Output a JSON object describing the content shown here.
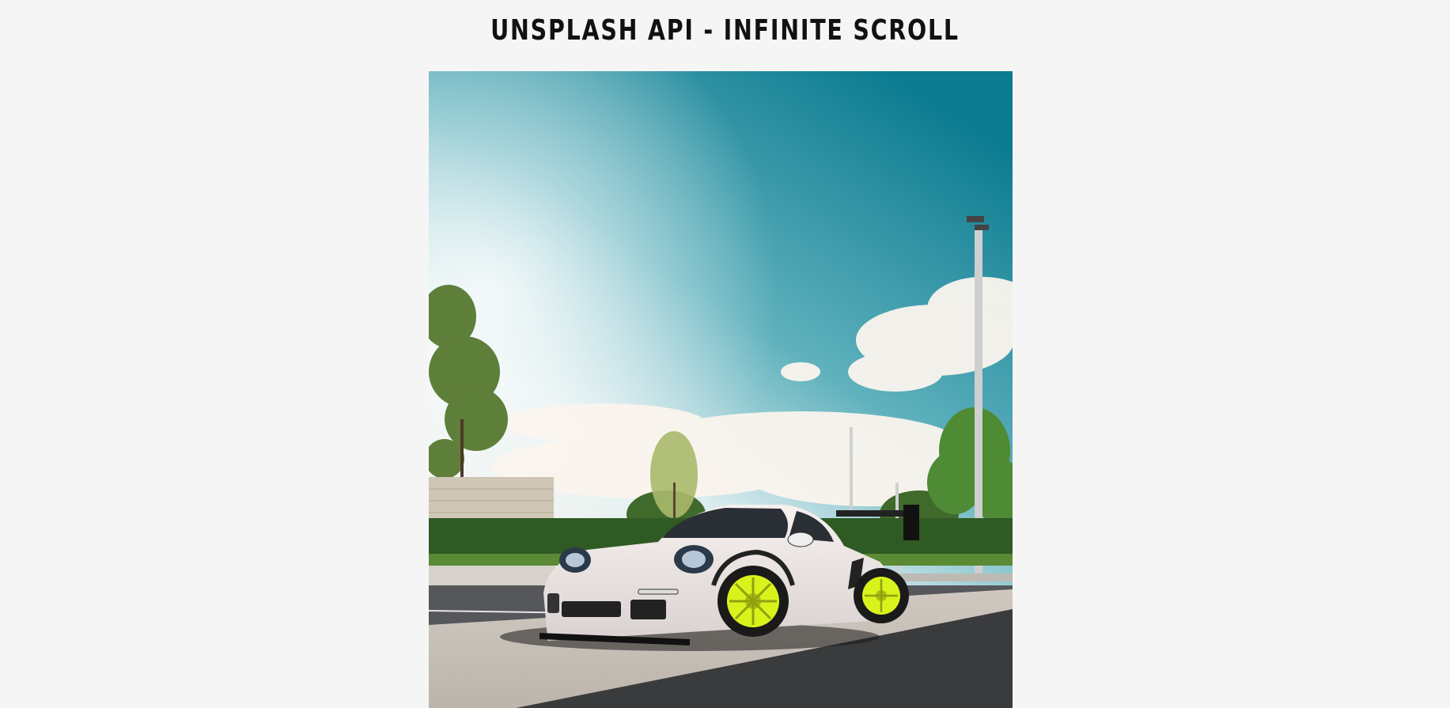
{
  "header": {
    "title": "UNSPLASH API - INFINITE SCROLL"
  },
  "gallery": {
    "images": [
      {
        "subject": "white sports car with neon yellow wheels in parking lot"
      }
    ]
  },
  "colors": {
    "background": "#f5f5f5",
    "title": "#111111",
    "sky_top": "#0f7e92",
    "wheel": "#d8f21c"
  }
}
